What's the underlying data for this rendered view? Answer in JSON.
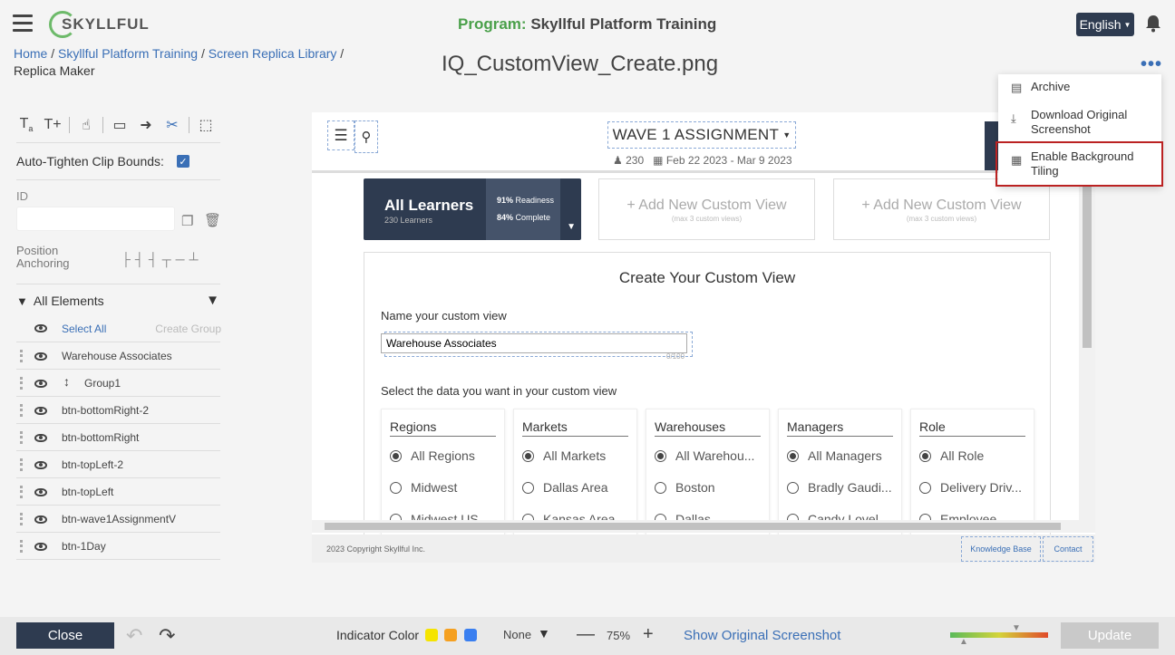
{
  "header": {
    "logo_text": "SKYLLFUL",
    "program_label": "Program:",
    "program_name": "Skyllful Platform Training",
    "language": "English"
  },
  "breadcrumb": {
    "items": [
      "Home",
      "Skyllful Platform Training",
      "Screen Replica Library"
    ],
    "current": "Replica Maker",
    "separator": "/"
  },
  "file_title": "IQ_CustomView_Create.png",
  "left_panel": {
    "auto_tighten_label": "Auto-Tighten Clip Bounds:",
    "auto_tighten_checked": true,
    "id_label": "ID",
    "id_value": "",
    "position_anchoring_label": "Position Anchoring",
    "filter_label": "All Elements",
    "select_all": "Select All",
    "create_group": "Create Group",
    "layers": [
      "Warehouse Associates",
      "Group1",
      "btn-bottomRight-2",
      "btn-bottomRight",
      "btn-topLeft-2",
      "btn-topLeft",
      "btn-wave1AssignmentV",
      "btn-1Day"
    ]
  },
  "canvas": {
    "wave_title": "WAVE 1 ASSIGNMENT",
    "learner_count": "230",
    "date_range": "Feb 22 2023 - Mar 9 2023",
    "all_learners": {
      "title": "All Learners",
      "subtitle": "230 Learners",
      "readiness_pct": "91%",
      "readiness_label": "Readiness",
      "complete_pct": "84%",
      "complete_label": "Complete"
    },
    "add_view": {
      "label": "+ Add New Custom View",
      "sublabel": "(max 3 custom views)"
    },
    "create": {
      "title": "Create Your Custom View",
      "name_label": "Name your custom view",
      "name_value": "Warehouse Associates",
      "name_count": "0/100",
      "data_label": "Select the data you want in your custom view"
    },
    "filters": [
      {
        "header": "Regions",
        "options": [
          "All Regions",
          "Midwest",
          "Midwest US"
        ],
        "selected": 0
      },
      {
        "header": "Markets",
        "options": [
          "All Markets",
          "Dallas Area",
          "Kansas Area"
        ],
        "selected": 0
      },
      {
        "header": "Warehouses",
        "options": [
          "All Warehou...",
          "Boston",
          "Dallas"
        ],
        "selected": 0
      },
      {
        "header": "Managers",
        "options": [
          "All Managers",
          "Bradly Gaudi...",
          "Candy Lovel..."
        ],
        "selected": 0
      },
      {
        "header": "Role",
        "options": [
          "All Role",
          "Delivery Driv...",
          "Employee"
        ],
        "selected": 0
      }
    ],
    "footer": {
      "copyright": "2023 Copyright Skyllful Inc.",
      "knowledge_base": "Knowledge Base",
      "contact": "Contact"
    }
  },
  "menu": {
    "archive": "Archive",
    "download": "Download Original Screenshot",
    "tiling": "Enable Background Tiling"
  },
  "bottom_bar": {
    "close": "Close",
    "indicator_label": "Indicator Color",
    "indicator_colors": [
      "#f5e400",
      "#f5a020",
      "#3a7ff0"
    ],
    "none_label": "None",
    "zoom": "75%",
    "show_original": "Show Original Screenshot",
    "update": "Update"
  }
}
